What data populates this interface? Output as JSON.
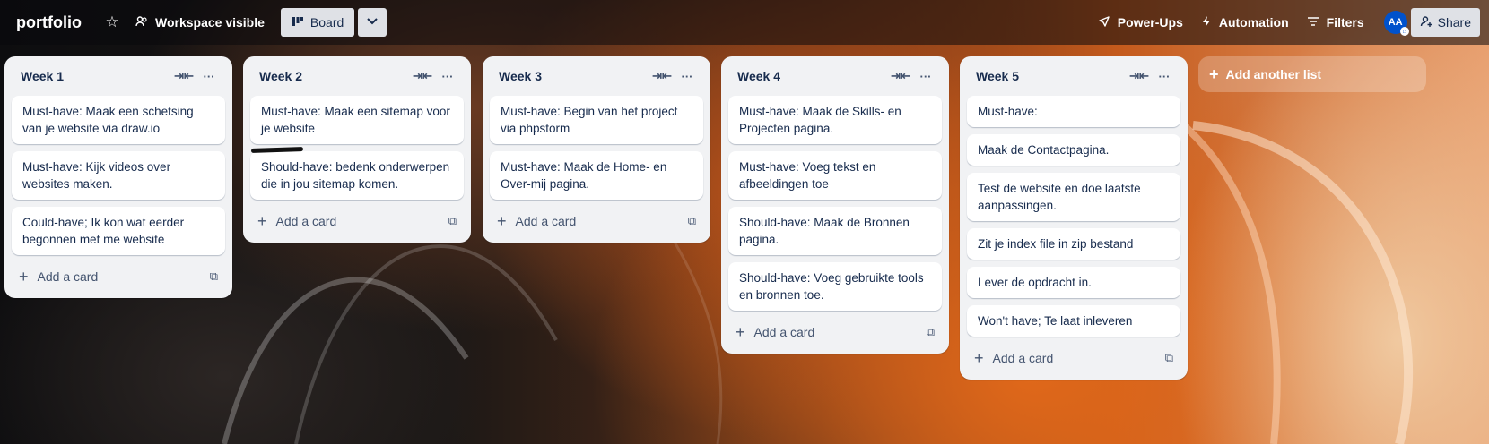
{
  "header": {
    "board_title": "portfolio",
    "workspace_label": "Workspace visible",
    "view_label": "Board",
    "powerups_label": "Power-Ups",
    "automation_label": "Automation",
    "filters_label": "Filters",
    "avatar_initials": "AA",
    "share_label": "Share"
  },
  "lists": [
    {
      "title": "Week 1",
      "cards": [
        "Must-have: Maak een schetsing van je website via draw.io",
        "Must-have: Kijk videos over websites maken.",
        "Could-have; Ik kon wat eerder begonnen met me website"
      ],
      "add_card_label": "Add a card"
    },
    {
      "title": "Week 2",
      "cards": [
        "Must-have: Maak een sitemap voor je website",
        "Should-have: bedenk onderwerpen die in jou sitemap komen."
      ],
      "add_card_label": "Add a card"
    },
    {
      "title": "Week 3",
      "cards": [
        "Must-have: Begin van het project via phpstorm",
        "Must-have: Maak de Home- en Over-mij pagina."
      ],
      "add_card_label": "Add a card"
    },
    {
      "title": "Week 4",
      "cards": [
        "Must-have: Maak de Skills- en Projecten pagina.",
        "Must-have: Voeg tekst en afbeeldingen toe",
        "Should-have: Maak de Bronnen pagina.",
        "Should-have: Voeg gebruikte tools en bronnen toe."
      ],
      "add_card_label": "Add a card"
    },
    {
      "title": "Week 5",
      "cards": [
        "Must-have:",
        "Maak de Contactpagina.",
        "Test de website en doe laatste aanpassingen.",
        "Zit je index file in zip bestand",
        "Lever de opdracht in.",
        "Won't have; Te laat inleveren"
      ],
      "add_card_label": "Add a card"
    }
  ],
  "add_list_label": "Add another list",
  "icons": {
    "star": "star-icon",
    "workspace": "people-icon",
    "board": "board-icon",
    "chevron": "chevron-down-icon",
    "powerups": "rocket-icon",
    "automation": "lightning-icon",
    "filters": "filter-icon",
    "collapse": "collapse-icon",
    "more": "more-icon",
    "plus": "plus-icon",
    "template": "template-icon"
  },
  "colors": {
    "list_bg": "#f1f2f4",
    "card_bg": "#ffffff",
    "text": "#172b4d",
    "avatar": "#0052cc"
  }
}
